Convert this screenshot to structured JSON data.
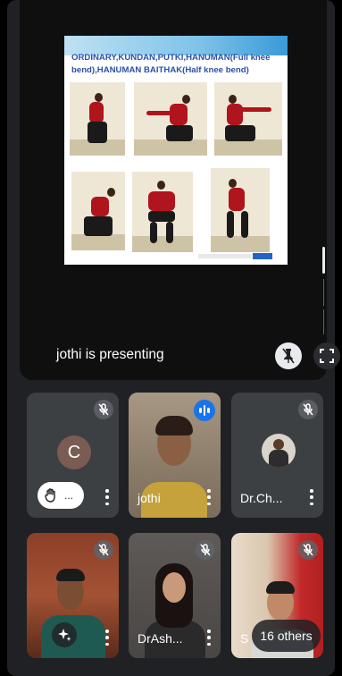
{
  "presentation": {
    "slide_title": "ORDINARY,KUNDAN,PUTKI,HANUMAN(Full knee bend),HANUMAN BAITHAK(Half knee bend)",
    "presenter_label": "jothi is presenting"
  },
  "tiles": [
    {
      "name": "",
      "avatar_letter": "C",
      "muted": true,
      "hand_raised": true,
      "hand_suffix": "..."
    },
    {
      "name": "jothi",
      "muted": false,
      "speaking": true
    },
    {
      "name": "Dr.Ch...",
      "muted": true
    },
    {
      "name": "",
      "muted": true
    },
    {
      "name": "DrAsh...",
      "muted": true
    },
    {
      "name": "S",
      "muted": true
    }
  ],
  "others": {
    "label": "16 others"
  },
  "icons": {
    "unpin": "unpin-icon",
    "fullscreen": "fullscreen-icon",
    "mic_off": "mic-off-icon",
    "hand": "raised-hand-icon",
    "sparkle": "sparkle-icon",
    "more": "more-vert-icon",
    "audio": "audio-level-icon"
  },
  "colors": {
    "accent": "#1a73e8",
    "background": "#202124",
    "tile": "#3c4043"
  }
}
